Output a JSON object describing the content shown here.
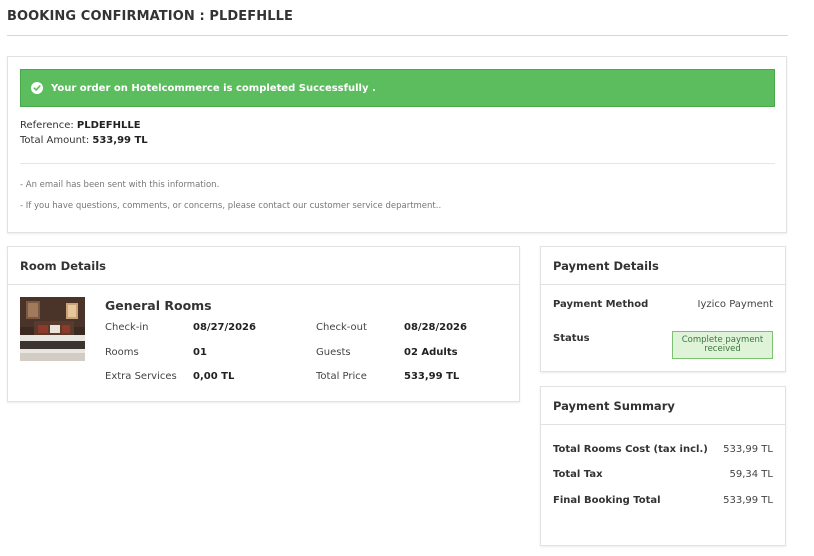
{
  "page": {
    "title": "BOOKING CONFIRMATION : PLDEFHLLE"
  },
  "confirmation": {
    "success_message": "Your order on Hotelcommerce is completed Successfully .",
    "reference_label": "Reference:",
    "reference_value": "PLDEFHLLE",
    "total_label": "Total Amount:",
    "total_value": "533,99 TL",
    "notes": [
      "- An email has been sent with this information.",
      "- If you have questions, comments, or concerns, please contact our customer service department.."
    ],
    "colors": {
      "success": "#5cbd5e"
    }
  },
  "room_details": {
    "header": "Room Details",
    "room_name": "General Rooms",
    "image_icon": "hotel-room-photo",
    "fields": {
      "checkin_label": "Check-in",
      "checkin_value": "08/27/2026",
      "checkout_label": "Check-out",
      "checkout_value": "08/28/2026",
      "rooms_label": "Rooms",
      "rooms_value": "01",
      "guests_label": "Guests",
      "guests_value": "02 Adults",
      "extra_label": "Extra Services",
      "extra_value": "0,00 TL",
      "total_label": "Total Price",
      "total_value": "533,99 TL"
    }
  },
  "payment_details": {
    "header": "Payment Details",
    "method_label": "Payment Method",
    "method_value": "Iyzico Payment",
    "status_label": "Status",
    "status_value": "Complete payment received",
    "colors": {
      "status_bg": "#dff3d8",
      "status_border": "#7cc070"
    }
  },
  "payment_summary": {
    "header": "Payment Summary",
    "rows": [
      {
        "label": "Total Rooms Cost (tax incl.)",
        "value": "533,99 TL"
      },
      {
        "label": "Total Tax",
        "value": "59,34 TL"
      },
      {
        "label": "Final Booking Total",
        "value": "533,99 TL"
      }
    ]
  }
}
